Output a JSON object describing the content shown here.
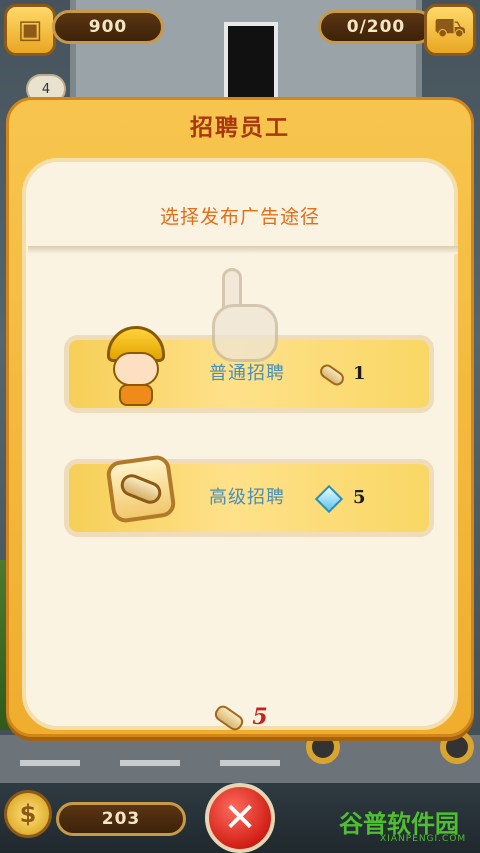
{
  "hud": {
    "coins_top": "900",
    "capacity": "0/200",
    "level_badge": "4",
    "money_bottom": "203"
  },
  "dialog": {
    "title": "招聘员工",
    "subtitle": "选择发布广告途径",
    "options": [
      {
        "label": "普通招聘",
        "cost_icon": "scroll-icon",
        "cost": "1"
      },
      {
        "label": "高级招聘",
        "cost_icon": "diamond-icon",
        "cost": "5"
      }
    ],
    "total_icon": "scroll-icon",
    "total": "5"
  },
  "watermark": {
    "text": "谷普软件园",
    "sub": "XIANPENGI.COM"
  },
  "colors": {
    "dialog_bg": "#f5bb3e",
    "panel_bg": "#fbf3e2",
    "title": "#a8380f",
    "subtitle": "#e06f1a",
    "option_label": "#4a8fb5",
    "total": "#c9221b",
    "close_button": "#d11f16"
  }
}
